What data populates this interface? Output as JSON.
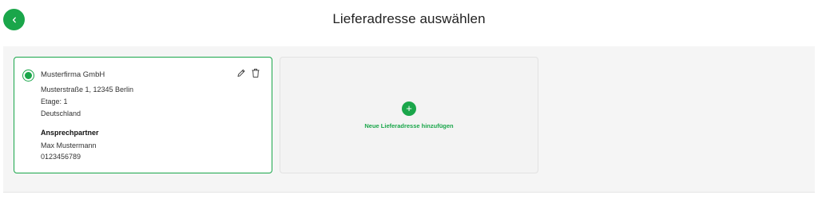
{
  "header": {
    "back_icon": "chevron-left-icon",
    "title": "Lieferadresse auswählen"
  },
  "address_card": {
    "selected": true,
    "company": "Musterfirma GmbH",
    "street_line": "Musterstraße 1, 12345 Berlin",
    "floor_line": "Etage: 1",
    "country": "Deutschland",
    "contact_heading": "Ansprechpartner",
    "contact_name": "Max Mustermann",
    "contact_phone": "0123456789",
    "edit_icon": "pencil-icon",
    "delete_icon": "trash-icon"
  },
  "new_address": {
    "icon": "plus-icon",
    "plus_glyph": "+",
    "label": "Neue Lieferadresse hinzufügen"
  },
  "colors": {
    "accent": "#1aa64a",
    "panel_background": "#f5f5f5"
  }
}
